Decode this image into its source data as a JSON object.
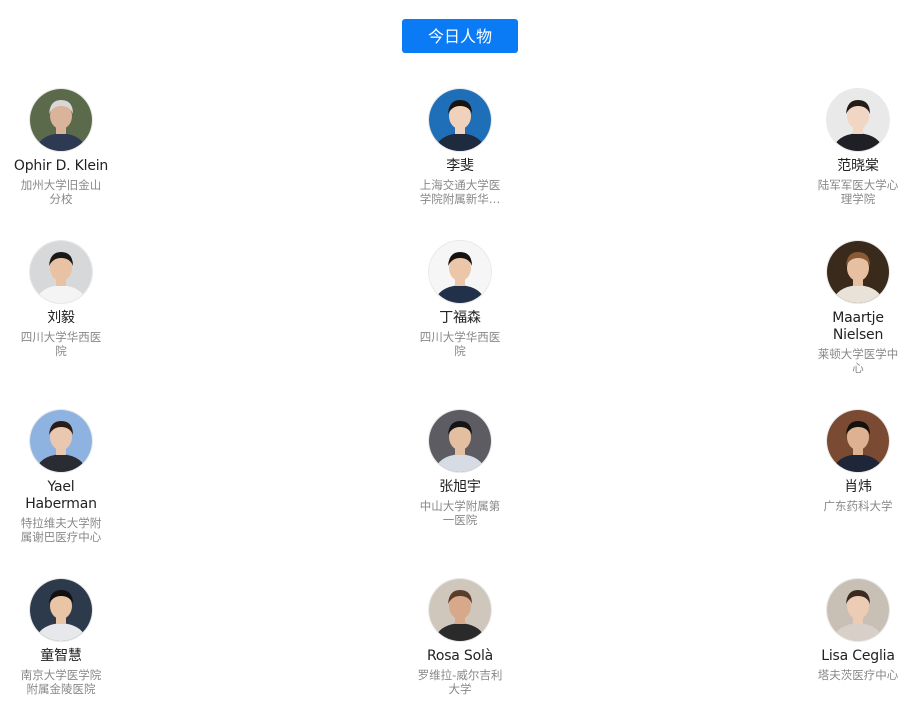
{
  "header": {
    "title": "今日人物"
  },
  "people": [
    {
      "name": "Ophir D. Klein",
      "affiliation": "加州大学旧金山分校",
      "colors": {
        "bg": "#5a6a4a",
        "skin": "#d9b39a",
        "hair": "#d8d8d8",
        "cloth": "#2e3a52"
      }
    },
    {
      "name": "李斐",
      "affiliation": "上海交通大学医学院附属新华医院",
      "colors": {
        "bg": "#1f6fb8",
        "skin": "#f0d2bc",
        "hair": "#1a1410",
        "cloth": "#1e2a3e"
      }
    },
    {
      "name": "范晓棠",
      "affiliation": "陆军军医大学心理学院",
      "colors": {
        "bg": "#e9e9e9",
        "skin": "#f1d6c4",
        "hair": "#241c18",
        "cloth": "#1f1f26"
      }
    },
    {
      "name": "刘毅",
      "affiliation": "四川大学华西医院",
      "colors": {
        "bg": "#d6d8da",
        "skin": "#e8c2a3",
        "hair": "#1b1714",
        "cloth": "#f4f4f4"
      }
    },
    {
      "name": "丁福森",
      "affiliation": "四川大学华西医院",
      "colors": {
        "bg": "#f6f6f6",
        "skin": "#ecc6a8",
        "hair": "#151210",
        "cloth": "#22304a"
      }
    },
    {
      "name": "Maartje Nielsen",
      "affiliation": "莱顿大学医学中心",
      "colors": {
        "bg": "#3a2a1c",
        "skin": "#e6c0a0",
        "hair": "#8a5a34",
        "cloth": "#e8e2d8"
      }
    },
    {
      "name": "Yael Haberman",
      "affiliation": "特拉维夫大学附属谢巴医疗中心",
      "colors": {
        "bg": "#8fb3e0",
        "skin": "#eac8b0",
        "hair": "#2a1d16",
        "cloth": "#2b2b33"
      }
    },
    {
      "name": "张旭宇",
      "affiliation": "中山大学附属第一医院",
      "colors": {
        "bg": "#5c5c62",
        "skin": "#e4bea0",
        "hair": "#151313",
        "cloth": "#d6dbe4"
      }
    },
    {
      "name": "肖炜",
      "affiliation": "广东药科大学",
      "colors": {
        "bg": "#7a4a32",
        "skin": "#dcb292",
        "hair": "#15110e",
        "cloth": "#1e2638"
      }
    },
    {
      "name": "童智慧",
      "affiliation": "南京大学医学院附属金陵医院",
      "colors": {
        "bg": "#2c3a4c",
        "skin": "#e9c5a6",
        "hair": "#121010",
        "cloth": "#e6e8ec"
      }
    },
    {
      "name": "Rosa Solà",
      "affiliation": "罗维拉-威尔吉利大学",
      "colors": {
        "bg": "#cfc6bc",
        "skin": "#d7a98a",
        "hair": "#5a3c2a",
        "cloth": "#2a2a2a"
      }
    },
    {
      "name": "Lisa Ceglia",
      "affiliation": "塔夫茨医疗中心",
      "colors": {
        "bg": "#c8c0b4",
        "skin": "#ecccb4",
        "hair": "#3a2a22",
        "cloth": "#d8d0c8"
      }
    }
  ]
}
